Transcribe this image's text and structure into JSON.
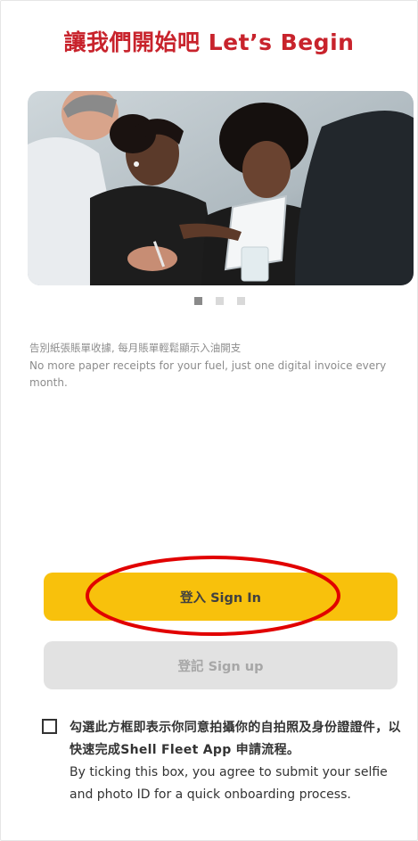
{
  "header": {
    "title": "讓我們開始吧 Let’s Begin"
  },
  "carousel": {
    "image_alt": "four colleagues reviewing a tablet together",
    "pages_total": 3,
    "active_index": 0
  },
  "slide": {
    "text_zh": "告別紙張賬單收據, 每月賬單輕鬆顯示入油開支",
    "text_en": "No more paper receipts for your fuel, just one digital invoice every month."
  },
  "buttons": {
    "sign_in": "登入 Sign In",
    "sign_up": "登記 Sign up"
  },
  "consent": {
    "checked": false,
    "text_zh": "勾選此方框即表示你同意拍攝你的自拍照及身份證證件，以快速完成Shell Fleet App 申請流程。",
    "text_en": "By ticking this box, you agree to submit your selfie and photo ID for a quick onboarding process."
  },
  "colors": {
    "brand_red": "#c8232c",
    "primary_yellow": "#f8c10c",
    "disabled_gray": "#e2e2e2",
    "annotation_red": "#e10000"
  }
}
